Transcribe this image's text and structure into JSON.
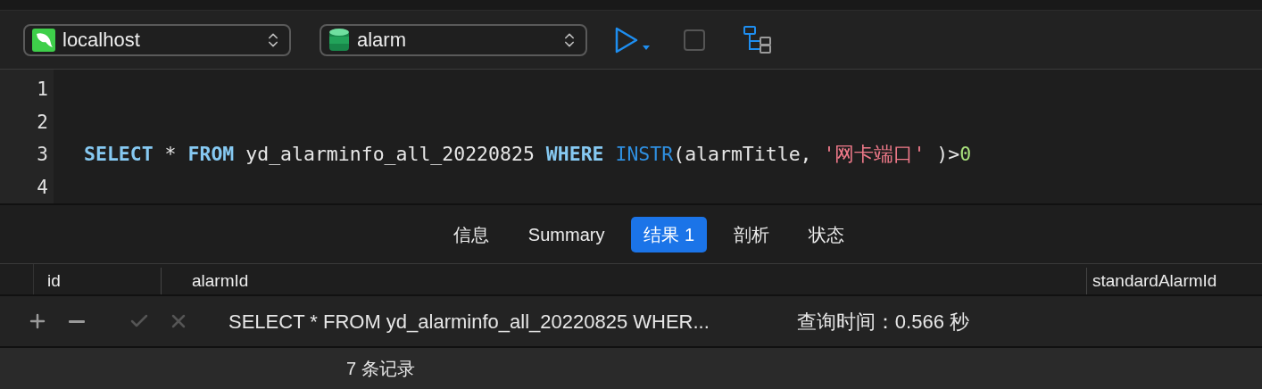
{
  "toolbar": {
    "connection": {
      "value": "localhost"
    },
    "database": {
      "value": "alarm"
    }
  },
  "editor": {
    "lines": [
      {
        "number": "1"
      },
      {
        "number": "2"
      },
      {
        "number": "3",
        "tokens": [
          {
            "kind": "keyword",
            "text": "SELECT"
          },
          {
            "kind": "plain",
            "text": " * "
          },
          {
            "kind": "keyword",
            "text": "FROM"
          },
          {
            "kind": "plain",
            "text": " yd_alarminfo_all_20220825 "
          },
          {
            "kind": "keyword",
            "text": "WHERE"
          },
          {
            "kind": "function",
            "text": " INSTR"
          },
          {
            "kind": "plain",
            "text": "(alarmTitle, "
          },
          {
            "kind": "string",
            "text": "'网卡端口'"
          },
          {
            "kind": "plain",
            "text": " )>"
          },
          {
            "kind": "number",
            "text": "0"
          }
        ]
      },
      {
        "number": "4"
      }
    ]
  },
  "tabs": [
    {
      "label": "信息",
      "selected": false
    },
    {
      "label": "Summary",
      "selected": false
    },
    {
      "label": "结果 1",
      "selected": true
    },
    {
      "label": "剖析",
      "selected": false
    },
    {
      "label": "状态",
      "selected": false
    }
  ],
  "table": {
    "columns": [
      "id",
      "alarmId",
      "standardAlarmId"
    ]
  },
  "actions": [
    {
      "kind": "add",
      "disabled": false
    },
    {
      "kind": "remove",
      "disabled": false
    },
    {
      "kind": "apply",
      "disabled": true
    },
    {
      "kind": "discard",
      "disabled": true
    }
  ],
  "query": "SELECT * FROM yd_alarminfo_all_20220825 WHER...",
  "query_time": "查询时间：0.566 秒",
  "status_bar": {
    "records": "7 条记录"
  }
}
